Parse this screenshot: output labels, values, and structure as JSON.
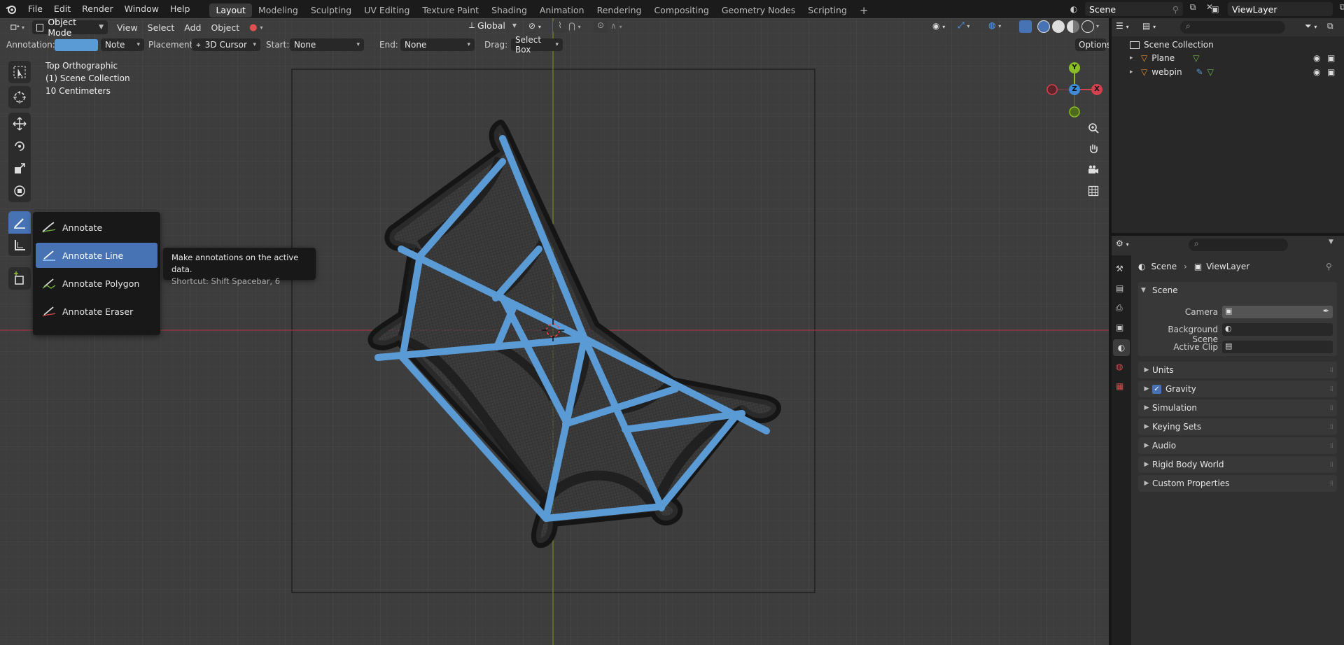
{
  "menu": {
    "items": [
      "File",
      "Edit",
      "Render",
      "Window",
      "Help"
    ]
  },
  "workspaces": {
    "tabs": [
      "Layout",
      "Modeling",
      "Sculpting",
      "UV Editing",
      "Texture Paint",
      "Shading",
      "Animation",
      "Rendering",
      "Compositing",
      "Geometry Nodes",
      "Scripting"
    ],
    "active": "Layout"
  },
  "top_right": {
    "scene_name": "Scene",
    "view_layer_name": "ViewLayer"
  },
  "viewport_header": {
    "mode": "Object Mode",
    "menus": [
      "View",
      "Select",
      "Add",
      "Object"
    ],
    "transform_orientation": "Global"
  },
  "tool_settings": {
    "annotation_label": "Annotation:",
    "annotation_type": "Note",
    "placement_label": "Placement:",
    "placement_value": "3D Cursor",
    "start_label": "Start:",
    "start_value": "None",
    "end_label": "End:",
    "end_value": "None",
    "drag_label": "Drag:",
    "drag_value": "Select Box",
    "options_label": "Options",
    "annotation_color": "#5b9bd5"
  },
  "viewport_info": {
    "view_name": "Top Orthographic",
    "collection": "(1) Scene Collection",
    "scale": "10 Centimeters"
  },
  "gizmo": {
    "y": "Y",
    "z": "Z",
    "x": "X"
  },
  "tool_popup": {
    "items": [
      "Annotate",
      "Annotate Line",
      "Annotate Polygon",
      "Annotate Eraser"
    ],
    "selected": "Annotate Line"
  },
  "tooltip": {
    "line1": "Make annotations on the active data.",
    "line2": "Shortcut: Shift Spacebar, 6"
  },
  "outliner": {
    "root": "Scene Collection",
    "objects": [
      "Plane",
      "webpin"
    ]
  },
  "properties": {
    "breadcrumb_scene": "Scene",
    "breadcrumb_layer": "ViewLayer",
    "scene_panel": "Scene",
    "camera_label": "Camera",
    "background_scene_label": "Background Scene",
    "active_clip_label": "Active Clip",
    "panels": [
      "Units",
      "Gravity",
      "Simulation",
      "Keying Sets",
      "Audio",
      "Rigid Body World",
      "Custom Properties"
    ],
    "gravity_checked": true
  },
  "colors": {
    "active_blue": "#4772b3",
    "x_axis": "#d5404f",
    "y_axis": "#8bbd27",
    "z_axis": "#3e8cd8"
  }
}
